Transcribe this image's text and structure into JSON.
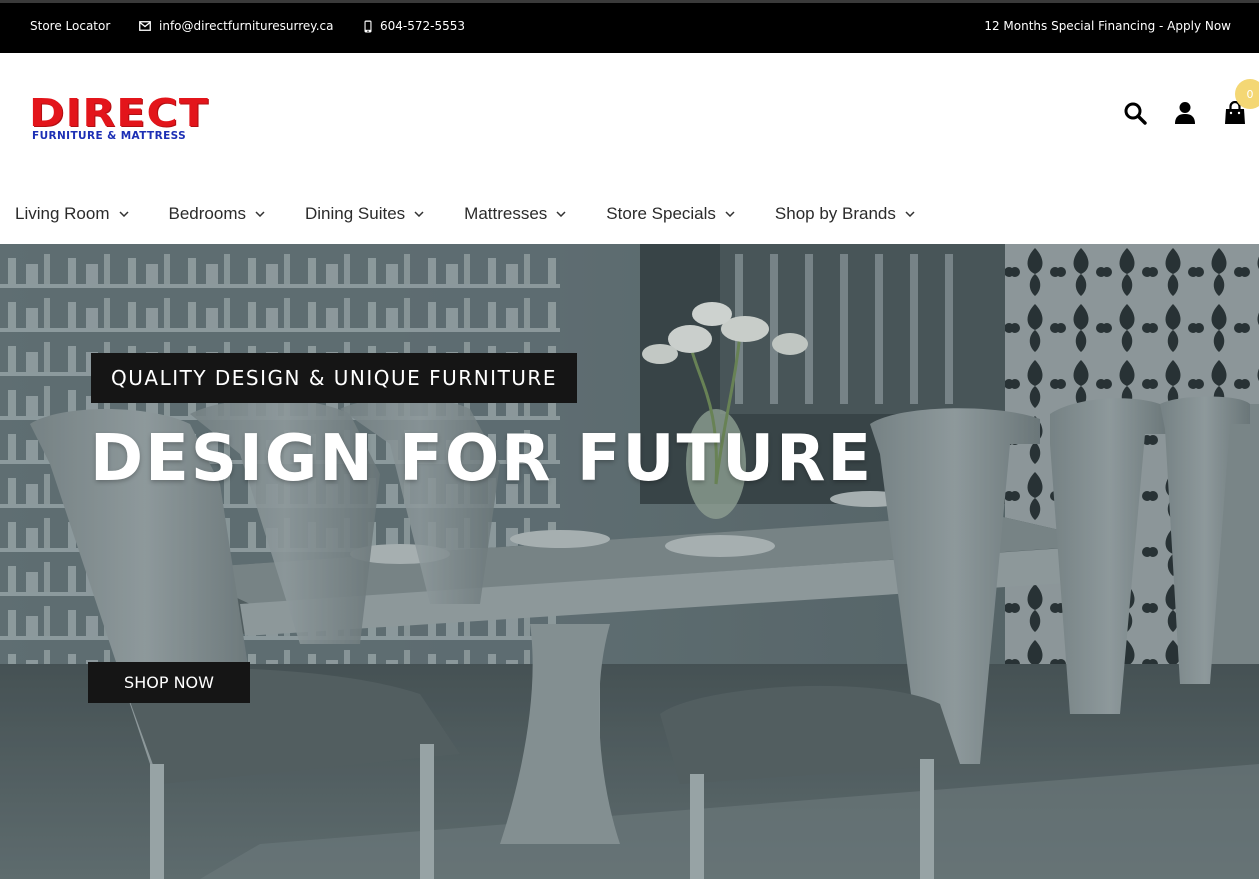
{
  "topbar": {
    "store_locator": "Store Locator",
    "email": "info@directfurnituresurrey.ca",
    "phone": "604-572-5553",
    "financing": "12 Months Special Financing - Apply Now"
  },
  "logo": {
    "main": "DIRECT",
    "sub": "FURNITURE & MATTRESS",
    "colors": {
      "main": "#e3151b",
      "sub": "#1c2fb5"
    }
  },
  "header": {
    "icons": [
      "search-icon",
      "user-icon",
      "shopping-bag-icon"
    ],
    "cart_count": "0"
  },
  "nav": {
    "items": [
      {
        "label": "Living Room"
      },
      {
        "label": "Bedrooms"
      },
      {
        "label": "Dining Suites"
      },
      {
        "label": "Mattresses"
      },
      {
        "label": "Store Specials"
      },
      {
        "label": "Shop by Brands"
      }
    ]
  },
  "hero": {
    "tagline": "QUALITY DESIGN & UNIQUE FURNITURE",
    "headline": "DESIGN FOR FUTURE",
    "cta": "SHOP NOW"
  }
}
